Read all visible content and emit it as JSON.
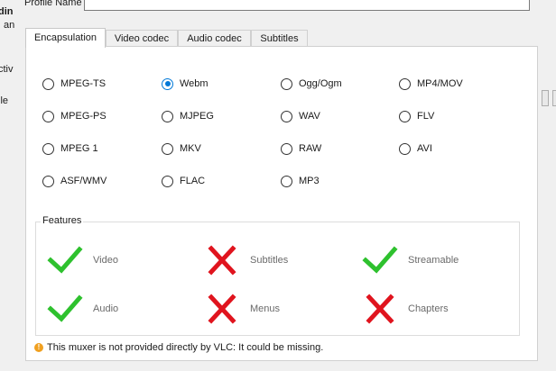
{
  "profile": {
    "label": "Profile Name",
    "value": ""
  },
  "background_fragments": [
    "din",
    "an",
    "ctiv",
    "ile"
  ],
  "tabs": [
    "Encapsulation",
    "Video codec",
    "Audio codec",
    "Subtitles"
  ],
  "active_tab": "Encapsulation",
  "encapsulation": {
    "selected": "Webm",
    "options": [
      "MPEG-TS",
      "Webm",
      "Ogg/Ogm",
      "MP4/MOV",
      "MPEG-PS",
      "MJPEG",
      "WAV",
      "FLV",
      "MPEG 1",
      "MKV",
      "RAW",
      "AVI",
      "ASF/WMV",
      "FLAC",
      "MP3"
    ]
  },
  "features": {
    "title": "Features",
    "items": [
      {
        "label": "Video",
        "supported": true,
        "icon": "check-icon"
      },
      {
        "label": "Subtitles",
        "supported": false,
        "icon": "cross-icon"
      },
      {
        "label": "Streamable",
        "supported": true,
        "icon": "check-icon"
      },
      {
        "label": "Audio",
        "supported": true,
        "icon": "check-icon"
      },
      {
        "label": "Menus",
        "supported": false,
        "icon": "cross-icon"
      },
      {
        "label": "Chapters",
        "supported": false,
        "icon": "cross-icon"
      }
    ]
  },
  "note": {
    "icon": "info-icon",
    "text": "This muxer is not provided directly by VLC: It could be missing."
  },
  "colors": {
    "check": "#2ec12e",
    "cross": "#e0141e",
    "radio_selected": "#0078d7",
    "note_icon": "#f0a020"
  }
}
